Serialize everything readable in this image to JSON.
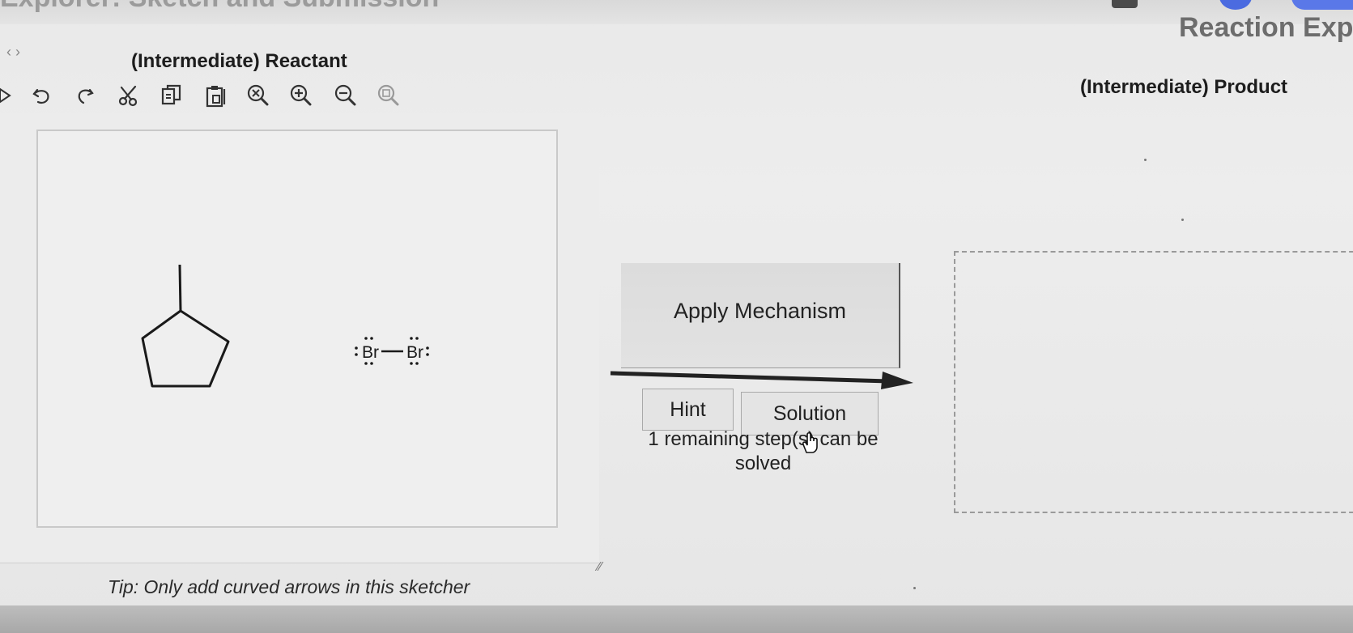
{
  "header": {
    "partial_title": "Explorer: Sketch and Submission",
    "right_partial_title": "Reaction Exp"
  },
  "reactant_panel": {
    "title": "(Intermediate) Reactant",
    "tip": "Tip: Only add curved arrows in this sketcher",
    "toolbar": [
      {
        "name": "undo-icon"
      },
      {
        "name": "redo-icon"
      },
      {
        "name": "cut-icon"
      },
      {
        "name": "copy-icon"
      },
      {
        "name": "paste-icon"
      },
      {
        "name": "zoom-reset-icon"
      },
      {
        "name": "zoom-in-icon"
      },
      {
        "name": "zoom-out-icon"
      },
      {
        "name": "zoom-fit-icon"
      }
    ],
    "molecules": {
      "left_atom_label": "Br",
      "right_atom_label": "Br"
    }
  },
  "mechanism": {
    "apply_label": "Apply Mechanism",
    "hint_label": "Hint",
    "solution_label": "Solution",
    "remaining_text": "1 remaining step(s) can be solved"
  },
  "product_panel": {
    "title": "(Intermediate) Product"
  },
  "colors": {
    "background": "#ebebeb",
    "accent_blue": "#4b6be0",
    "button_bg": "#e4e4e4"
  }
}
